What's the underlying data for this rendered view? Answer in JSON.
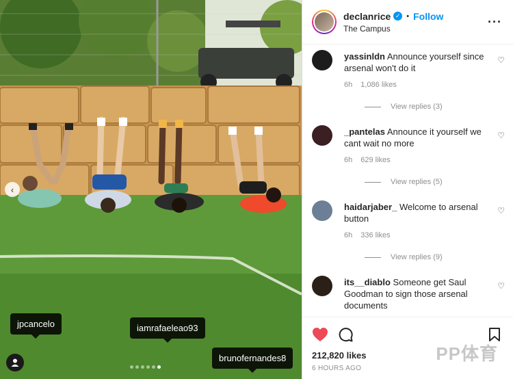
{
  "post": {
    "username": "declanrice",
    "verified_icon": "verified-badge-icon",
    "separator": "•",
    "follow_label": "Follow",
    "location": "The Campus",
    "more_icon": "more-options-icon"
  },
  "photo": {
    "tags": [
      "jpcancelo",
      "iamrafaeleao93",
      "brunofernandes8"
    ],
    "carousel_dots": 6,
    "active_dot": 5
  },
  "comments": [
    {
      "user": "yassinldn",
      "text": "Announce yourself since arsenal won't do it",
      "time": "6h",
      "likes": "1,086 likes",
      "replies": "View replies (3)"
    },
    {
      "user": "_pantelas",
      "text": "Announce it yourself we cant wait no more",
      "time": "6h",
      "likes": "629 likes",
      "replies": "View replies (5)"
    },
    {
      "user": "haidarjaber_",
      "text": "Welcome to arsenal button",
      "time": "6h",
      "likes": "336 likes",
      "replies": "View replies (9)"
    },
    {
      "user": "its__diablo",
      "text": "Someone get Saul Goodman to sign those arsenal documents",
      "time": "",
      "likes": "",
      "replies": ""
    }
  ],
  "footer": {
    "likes": "212,820 likes",
    "time": "6 HOURS AGO"
  },
  "watermark": "PP体育",
  "colors": {
    "accent": "#0095f6",
    "like_red": "#ed4956",
    "muted": "#8e8e8e"
  }
}
